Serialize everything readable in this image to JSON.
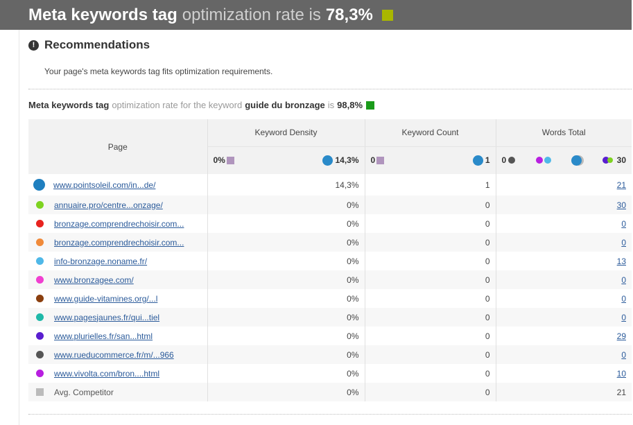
{
  "header": {
    "title_strong": "Meta keywords tag",
    "title_light": "optimization rate is",
    "rate": "78,3%",
    "rate_color": "#a9b700"
  },
  "recommendations": {
    "title": "Recommendations",
    "icon": "exclamation-circle-icon",
    "message": "Your page's meta keywords tag fits optimization requirements."
  },
  "keyword_section": {
    "label_strong": "Meta keywords tag",
    "label_light_1": "optimization rate for the keyword",
    "keyword": "guide du bronzage",
    "label_light_2": "is",
    "rate": "98,8%",
    "rate_color": "#1a9b1a"
  },
  "table": {
    "headers": {
      "page": "Page",
      "density": "Keyword Density",
      "count": "Keyword Count",
      "words": "Words Total"
    },
    "scale": {
      "density_min": "0%",
      "density_max": "14,3%",
      "count_min": "0",
      "count_max": "1",
      "words_min": "0",
      "words_max": "30"
    },
    "rows": [
      {
        "page": "www.pointsoleil.com/in...de/",
        "color": "#1f7fbf",
        "density": "14,3%",
        "count": "1",
        "words": "21",
        "link": true
      },
      {
        "page": "annuaire.pro/centre...onzage/",
        "color": "#7ed321",
        "density": "0%",
        "count": "0",
        "words": "30",
        "link": true
      },
      {
        "page": "bronzage.comprendrechoisir.com...",
        "color": "#e8231f",
        "density": "0%",
        "count": "0",
        "words": "0",
        "link": true
      },
      {
        "page": "bronzage.comprendrechoisir.com...",
        "color": "#f08a3a",
        "density": "0%",
        "count": "0",
        "words": "0",
        "link": true
      },
      {
        "page": "info-bronzage.noname.fr/",
        "color": "#4fb8e8",
        "density": "0%",
        "count": "0",
        "words": "13",
        "link": true
      },
      {
        "page": "www.bronzagee.com/",
        "color": "#f03fd0",
        "density": "0%",
        "count": "0",
        "words": "0",
        "link": true
      },
      {
        "page": "www.guide-vitamines.org/...l",
        "color": "#8b3f0f",
        "density": "0%",
        "count": "0",
        "words": "0",
        "link": true
      },
      {
        "page": "www.pagesjaunes.fr/qui...tiel",
        "color": "#1fb8a8",
        "density": "0%",
        "count": "0",
        "words": "0",
        "link": true
      },
      {
        "page": "www.plurielles.fr/san...html",
        "color": "#5a1fd0",
        "density": "0%",
        "count": "0",
        "words": "29",
        "link": true
      },
      {
        "page": "www.rueducommerce.fr/m/...966",
        "color": "#555555",
        "density": "0%",
        "count": "0",
        "words": "0",
        "link": true
      },
      {
        "page": "www.vivolta.com/bron....html",
        "color": "#b81fe0",
        "density": "0%",
        "count": "0",
        "words": "10",
        "link": true
      },
      {
        "page": "Avg. Competitor",
        "color": "#bbbbbb",
        "density": "0%",
        "count": "0",
        "words": "21",
        "link": false
      }
    ]
  }
}
